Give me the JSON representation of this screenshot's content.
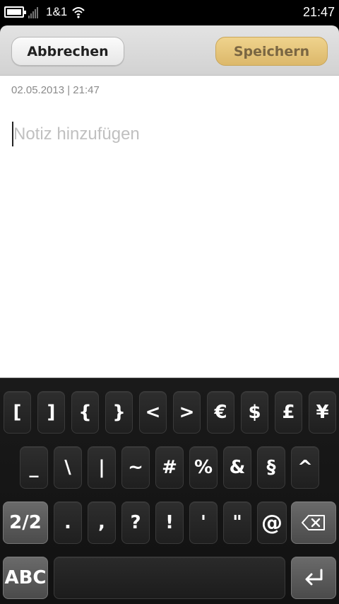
{
  "status_bar": {
    "carrier": "1&1",
    "time": "21:47",
    "battery_level": 1.0,
    "signal_level": 0
  },
  "header": {
    "cancel_label": "Abbrechen",
    "save_label": "Speichern"
  },
  "note": {
    "timestamp": "02.05.2013 | 21:47",
    "placeholder": "Notiz hinzufügen",
    "value": ""
  },
  "keyboard": {
    "row1": [
      "[",
      "]",
      "{",
      "}",
      "<",
      ">",
      "€",
      "$",
      "£",
      "¥"
    ],
    "row2": [
      "_",
      "\\",
      "|",
      "~",
      "#",
      "%",
      "&",
      "§",
      "^"
    ],
    "row3": [
      ".",
      ",",
      "?",
      "!",
      "'",
      "\""
    ],
    "page_label": "2/2",
    "at_key": "@",
    "abc_label": "ABC",
    "icons": {
      "backspace": "backspace-icon",
      "enter": "enter-icon"
    }
  }
}
